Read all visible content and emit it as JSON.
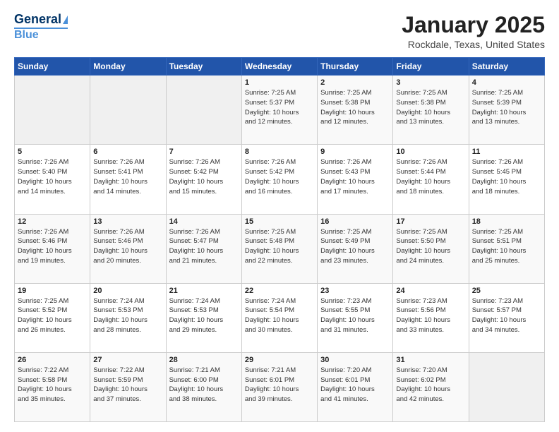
{
  "logo": {
    "line1": "General",
    "line2": "Blue"
  },
  "header": {
    "title": "January 2025",
    "subtitle": "Rockdale, Texas, United States"
  },
  "days_of_week": [
    "Sunday",
    "Monday",
    "Tuesday",
    "Wednesday",
    "Thursday",
    "Friday",
    "Saturday"
  ],
  "weeks": [
    [
      {
        "day": "",
        "info": ""
      },
      {
        "day": "",
        "info": ""
      },
      {
        "day": "",
        "info": ""
      },
      {
        "day": "1",
        "info": "Sunrise: 7:25 AM\nSunset: 5:37 PM\nDaylight: 10 hours\nand 12 minutes."
      },
      {
        "day": "2",
        "info": "Sunrise: 7:25 AM\nSunset: 5:38 PM\nDaylight: 10 hours\nand 12 minutes."
      },
      {
        "day": "3",
        "info": "Sunrise: 7:25 AM\nSunset: 5:38 PM\nDaylight: 10 hours\nand 13 minutes."
      },
      {
        "day": "4",
        "info": "Sunrise: 7:25 AM\nSunset: 5:39 PM\nDaylight: 10 hours\nand 13 minutes."
      }
    ],
    [
      {
        "day": "5",
        "info": "Sunrise: 7:26 AM\nSunset: 5:40 PM\nDaylight: 10 hours\nand 14 minutes."
      },
      {
        "day": "6",
        "info": "Sunrise: 7:26 AM\nSunset: 5:41 PM\nDaylight: 10 hours\nand 14 minutes."
      },
      {
        "day": "7",
        "info": "Sunrise: 7:26 AM\nSunset: 5:42 PM\nDaylight: 10 hours\nand 15 minutes."
      },
      {
        "day": "8",
        "info": "Sunrise: 7:26 AM\nSunset: 5:42 PM\nDaylight: 10 hours\nand 16 minutes."
      },
      {
        "day": "9",
        "info": "Sunrise: 7:26 AM\nSunset: 5:43 PM\nDaylight: 10 hours\nand 17 minutes."
      },
      {
        "day": "10",
        "info": "Sunrise: 7:26 AM\nSunset: 5:44 PM\nDaylight: 10 hours\nand 18 minutes."
      },
      {
        "day": "11",
        "info": "Sunrise: 7:26 AM\nSunset: 5:45 PM\nDaylight: 10 hours\nand 18 minutes."
      }
    ],
    [
      {
        "day": "12",
        "info": "Sunrise: 7:26 AM\nSunset: 5:46 PM\nDaylight: 10 hours\nand 19 minutes."
      },
      {
        "day": "13",
        "info": "Sunrise: 7:26 AM\nSunset: 5:46 PM\nDaylight: 10 hours\nand 20 minutes."
      },
      {
        "day": "14",
        "info": "Sunrise: 7:26 AM\nSunset: 5:47 PM\nDaylight: 10 hours\nand 21 minutes."
      },
      {
        "day": "15",
        "info": "Sunrise: 7:25 AM\nSunset: 5:48 PM\nDaylight: 10 hours\nand 22 minutes."
      },
      {
        "day": "16",
        "info": "Sunrise: 7:25 AM\nSunset: 5:49 PM\nDaylight: 10 hours\nand 23 minutes."
      },
      {
        "day": "17",
        "info": "Sunrise: 7:25 AM\nSunset: 5:50 PM\nDaylight: 10 hours\nand 24 minutes."
      },
      {
        "day": "18",
        "info": "Sunrise: 7:25 AM\nSunset: 5:51 PM\nDaylight: 10 hours\nand 25 minutes."
      }
    ],
    [
      {
        "day": "19",
        "info": "Sunrise: 7:25 AM\nSunset: 5:52 PM\nDaylight: 10 hours\nand 26 minutes."
      },
      {
        "day": "20",
        "info": "Sunrise: 7:24 AM\nSunset: 5:53 PM\nDaylight: 10 hours\nand 28 minutes."
      },
      {
        "day": "21",
        "info": "Sunrise: 7:24 AM\nSunset: 5:53 PM\nDaylight: 10 hours\nand 29 minutes."
      },
      {
        "day": "22",
        "info": "Sunrise: 7:24 AM\nSunset: 5:54 PM\nDaylight: 10 hours\nand 30 minutes."
      },
      {
        "day": "23",
        "info": "Sunrise: 7:23 AM\nSunset: 5:55 PM\nDaylight: 10 hours\nand 31 minutes."
      },
      {
        "day": "24",
        "info": "Sunrise: 7:23 AM\nSunset: 5:56 PM\nDaylight: 10 hours\nand 33 minutes."
      },
      {
        "day": "25",
        "info": "Sunrise: 7:23 AM\nSunset: 5:57 PM\nDaylight: 10 hours\nand 34 minutes."
      }
    ],
    [
      {
        "day": "26",
        "info": "Sunrise: 7:22 AM\nSunset: 5:58 PM\nDaylight: 10 hours\nand 35 minutes."
      },
      {
        "day": "27",
        "info": "Sunrise: 7:22 AM\nSunset: 5:59 PM\nDaylight: 10 hours\nand 37 minutes."
      },
      {
        "day": "28",
        "info": "Sunrise: 7:21 AM\nSunset: 6:00 PM\nDaylight: 10 hours\nand 38 minutes."
      },
      {
        "day": "29",
        "info": "Sunrise: 7:21 AM\nSunset: 6:01 PM\nDaylight: 10 hours\nand 39 minutes."
      },
      {
        "day": "30",
        "info": "Sunrise: 7:20 AM\nSunset: 6:01 PM\nDaylight: 10 hours\nand 41 minutes."
      },
      {
        "day": "31",
        "info": "Sunrise: 7:20 AM\nSunset: 6:02 PM\nDaylight: 10 hours\nand 42 minutes."
      },
      {
        "day": "",
        "info": ""
      }
    ]
  ]
}
